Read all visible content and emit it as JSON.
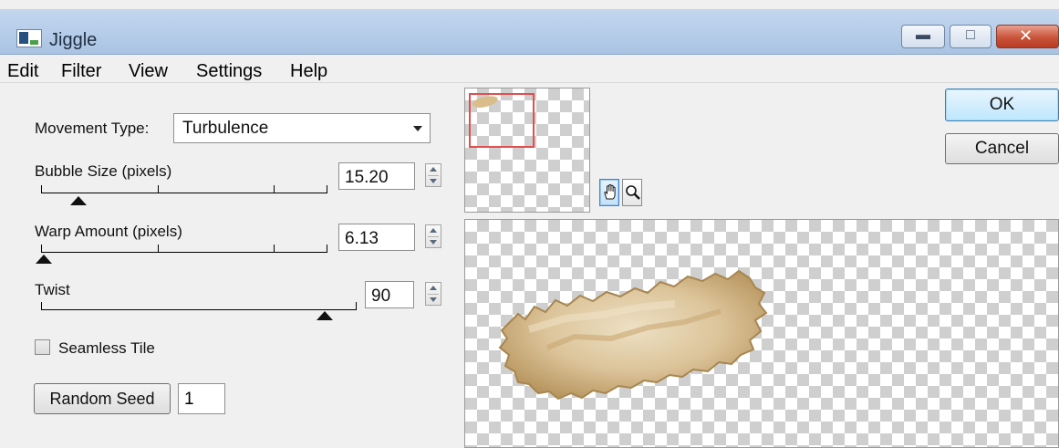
{
  "window": {
    "title": "Jiggle"
  },
  "menu": [
    "Edit",
    "Filter",
    "View",
    "Settings",
    "Help"
  ],
  "controls": {
    "movement_type": {
      "label": "Movement Type:",
      "value": "Turbulence"
    },
    "bubble_size": {
      "label": "Bubble Size (pixels)",
      "value": "15.20",
      "slider_fraction": 0.13
    },
    "warp_amount": {
      "label": "Warp Amount (pixels)",
      "value": "6.13",
      "slider_fraction": 0.01
    },
    "twist": {
      "label": "Twist",
      "value": "90",
      "slider_fraction": 0.9
    },
    "seamless_tile": {
      "label": "Seamless Tile",
      "checked": false
    },
    "random_seed": {
      "button_label": "Random Seed",
      "value": "1"
    }
  },
  "buttons": {
    "ok": "OK",
    "cancel": "Cancel"
  },
  "tools": {
    "pan": "hand-icon",
    "zoom": "magnifier-icon"
  },
  "colors": {
    "titlebar": "#b6cde9",
    "close_button": "#c9543a",
    "viewport_rect": "#e05050",
    "blob": "#d4b584"
  }
}
